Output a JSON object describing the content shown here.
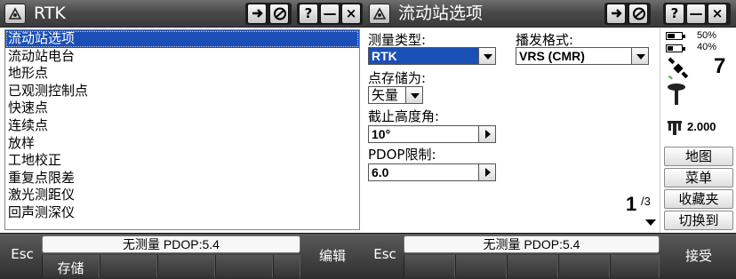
{
  "left": {
    "title": "RTK",
    "title_buttons": [
      "?",
      "—",
      "×"
    ],
    "list_items": [
      "流动站选项",
      "流动站电台",
      "地形点",
      "已观测控制点",
      "快速点",
      "连续点",
      "放样",
      "工地校正",
      "重复点限差",
      "激光测距仪",
      "回声测深仪"
    ],
    "selected_index": 0,
    "bottom": {
      "esc": "Esc",
      "status": "无测量  PDOP:5.4",
      "store": "存储",
      "edit": "编辑"
    }
  },
  "right": {
    "title": "流动站选项",
    "title_buttons": [
      "?",
      "—",
      "×"
    ],
    "form": {
      "survey_type_label": "测量类型:",
      "survey_type_value": "RTK",
      "broadcast_format_label": "播发格式:",
      "broadcast_format_value": "VRS (CMR)",
      "point_store_label": "点存储为:",
      "point_store_value": "矢量",
      "elevation_mask_label": "截止高度角:",
      "elevation_mask_value": "10°",
      "pdop_limit_label": "PDOP限制:",
      "pdop_limit_value": "6.0"
    },
    "pager": {
      "current": "1",
      "total": "/3"
    },
    "status": {
      "battery1": "50%",
      "battery1_level": 0.5,
      "battery2": "40%",
      "battery2_level": 0.4,
      "satellites": "7",
      "antenna_height": "2.000"
    },
    "side_buttons": [
      "地图",
      "菜单",
      "收藏夹",
      "切换到"
    ],
    "bottom": {
      "esc": "Esc",
      "status": "无测量  PDOP:5.4",
      "accept": "接受"
    }
  },
  "colors": {
    "selection": "#1a4fb6",
    "titlebar": "#4a4a4a",
    "bottombar": "#3a3a3a"
  }
}
